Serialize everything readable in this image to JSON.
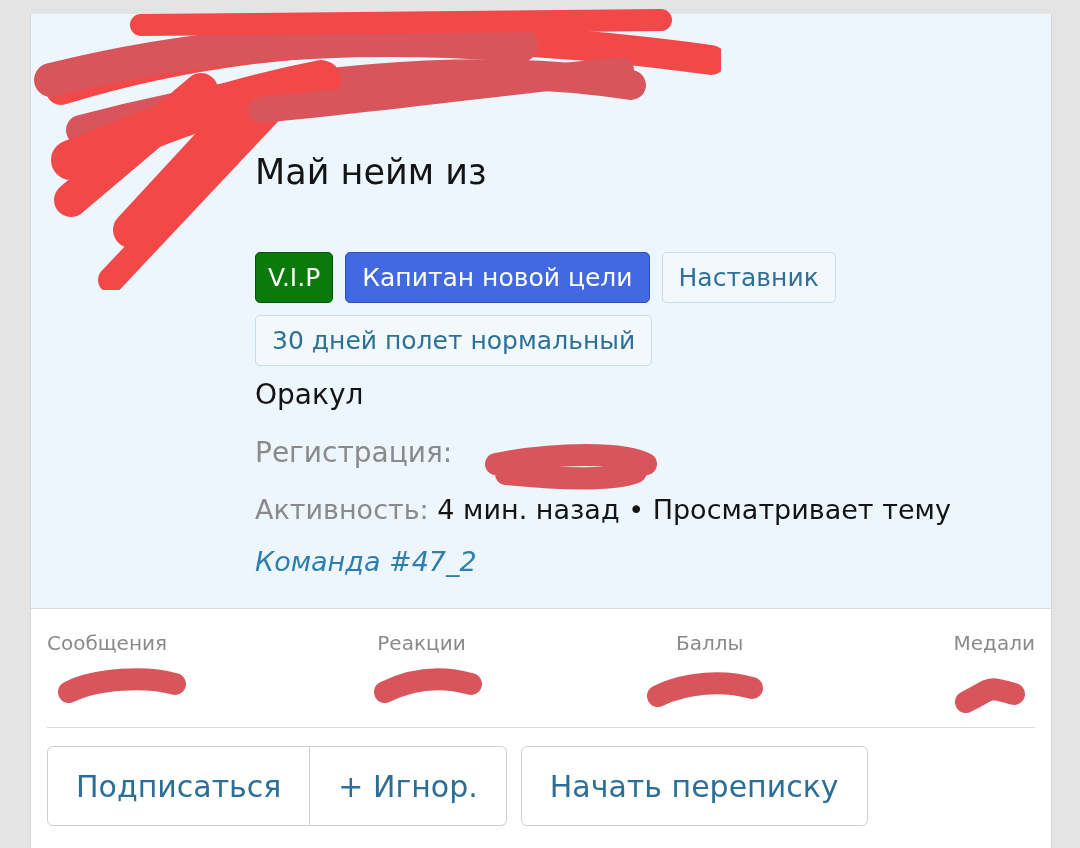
{
  "profile": {
    "name": "Май нейм из",
    "badges": [
      {
        "label": "V.I.P",
        "kind": "green"
      },
      {
        "label": "Капитан новой цели",
        "kind": "blue"
      },
      {
        "label": "Наставник",
        "kind": "outline"
      },
      {
        "label": "30 дней полет нормальный",
        "kind": "outline"
      }
    ],
    "title": "Оракул",
    "registration_label": "Регистрация:",
    "activity_label": "Активность:",
    "activity_text": "4 мин. назад • Просматривает тему",
    "activity_link": "Команда #47_2"
  },
  "stats": [
    {
      "label": "Сообщения"
    },
    {
      "label": "Реакции"
    },
    {
      "label": "Баллы"
    },
    {
      "label": "Медали"
    }
  ],
  "button_groups": [
    {
      "buttons": [
        {
          "label": "Подписаться"
        },
        {
          "label": "+ Игнор."
        }
      ]
    },
    {
      "buttons": [
        {
          "label": "Начать переписку"
        }
      ]
    }
  ]
}
